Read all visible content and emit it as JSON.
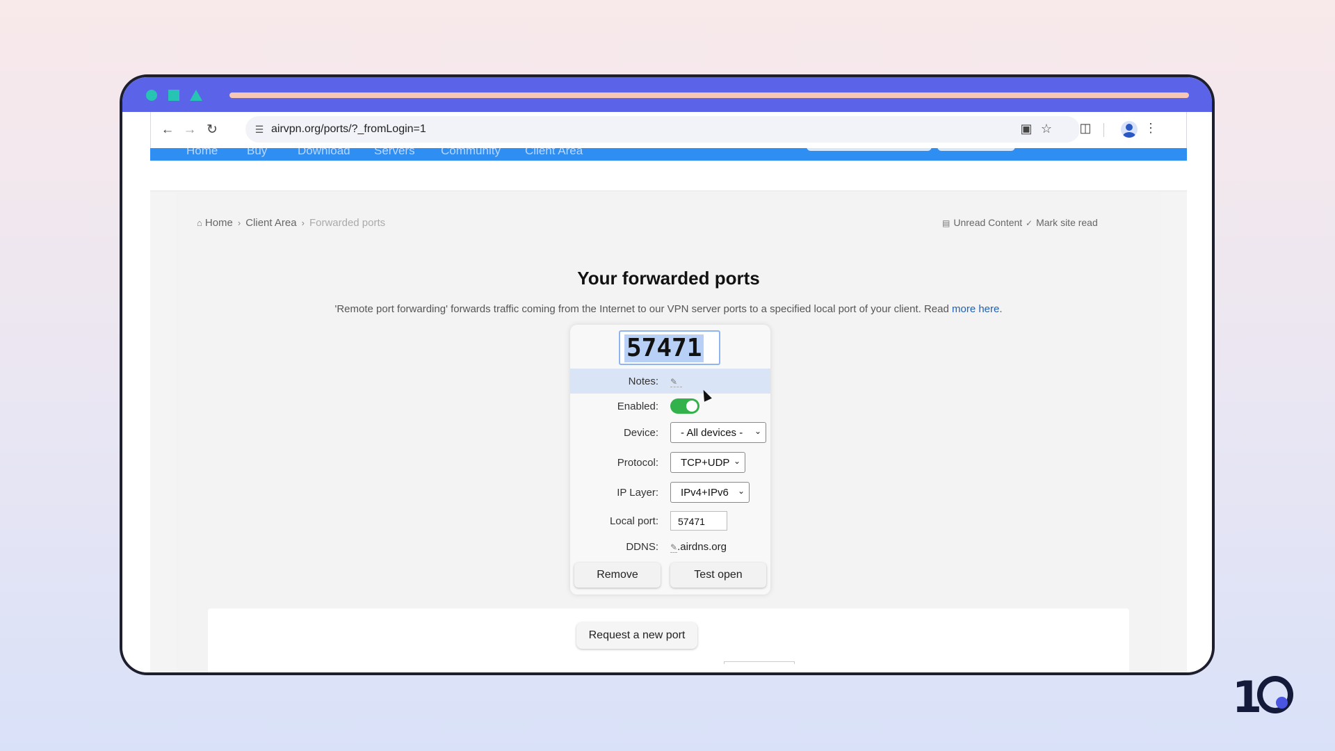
{
  "browser": {
    "url": "airvpn.org/ports/?_fromLogin=1"
  },
  "site_nav": {
    "items": [
      "Home",
      "Buy",
      "Download",
      "Servers",
      "Community",
      "Client Area"
    ]
  },
  "breadcrumb": {
    "home": "Home",
    "client_area": "Client Area",
    "current": "Forwarded ports",
    "unread": "Unread Content",
    "mark_read": "Mark site read"
  },
  "page": {
    "title": "Your forwarded ports",
    "description": "'Remote port forwarding' forwards traffic coming from the Internet to our VPN server ports to a specified local port of your client. Read ",
    "more_link": "more here",
    "period": "."
  },
  "port_card": {
    "port": "57471",
    "labels": {
      "notes": "Notes:",
      "enabled": "Enabled:",
      "device": "Device:",
      "protocol": "Protocol:",
      "ip_layer": "IP Layer:",
      "local_port": "Local port:",
      "ddns": "DDNS:"
    },
    "device_value": "- All devices -",
    "protocol_value": "TCP+UDP",
    "ip_layer_value": "IPv4+IPv6",
    "local_port_value": "57471",
    "ddns_value": ".airdns.org",
    "enabled": true,
    "remove_label": "Remove",
    "test_label": "Test open"
  },
  "panel": {
    "request_label": "Request a new port"
  },
  "colors": {
    "frame_top": "#5b63e8",
    "site_nav": "#2f8ef2",
    "toggle_on": "#33b14a",
    "link": "#1f5fb5"
  }
}
